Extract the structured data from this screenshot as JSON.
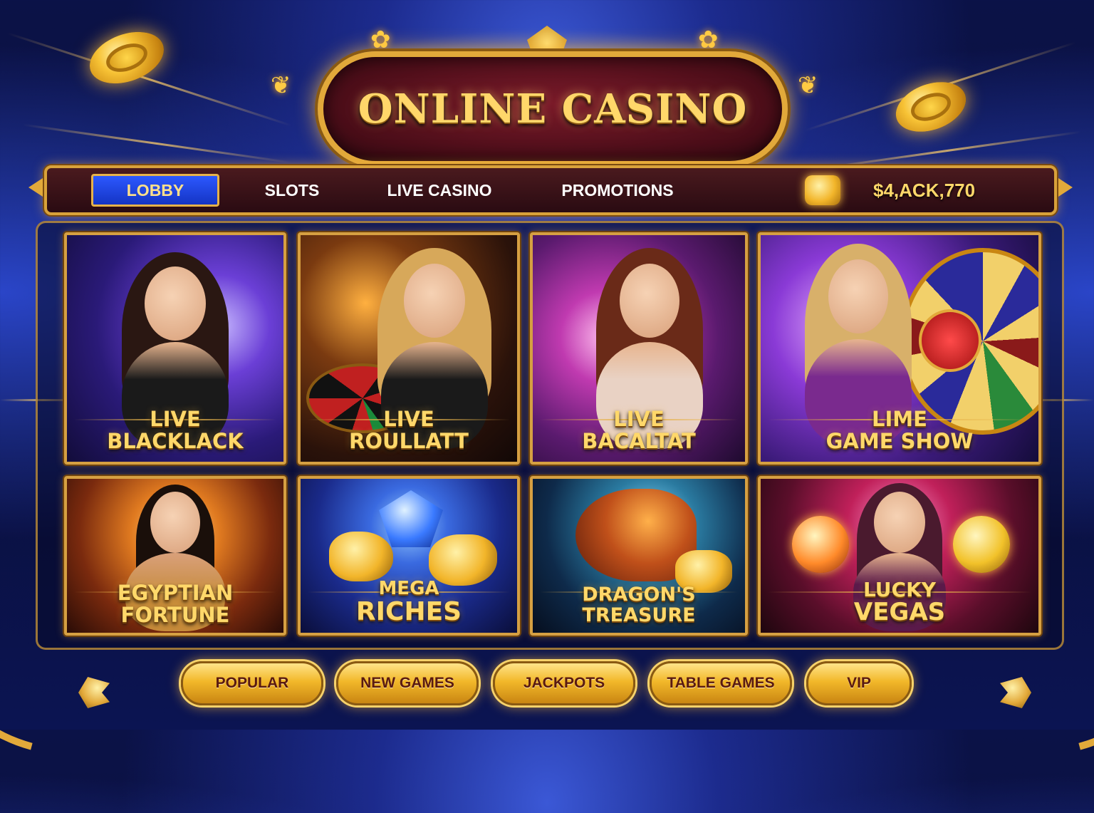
{
  "header": {
    "title": "ONLINE CASINO"
  },
  "nav": {
    "tabs": [
      {
        "label": "LOBBY",
        "active": true
      },
      {
        "label": "SLOTS",
        "active": false
      },
      {
        "label": "LIVE CASINO",
        "active": false
      },
      {
        "label": "PROMOTIONS",
        "active": false
      }
    ],
    "balance": "$4,ACK,770"
  },
  "games": [
    {
      "line1": "LIVE",
      "line2": "BLACKLACK"
    },
    {
      "line1": "LIVE",
      "line2": "ROULLATT"
    },
    {
      "line1": "LIVE",
      "line2": "BACALTAT"
    },
    {
      "line1": "LIME",
      "line2": "GAME SHOW"
    },
    {
      "line1": "EGYPTIAN",
      "line2": "FORTUNE"
    },
    {
      "line1": "MEGA",
      "line2": "RICHES"
    },
    {
      "line1": "DRAGON'S",
      "line2": "TREASURE"
    },
    {
      "line1": "LUCKY",
      "line2": "VEGAS"
    }
  ],
  "categories": [
    "POPULAR",
    "NEW GAMES",
    "JACKPOTS",
    "TABLE GAMES",
    "VIP"
  ],
  "colors": {
    "gold": "#e2a93a",
    "nav_active": "#1f48e8",
    "plaque": "#5a1220"
  },
  "icons": [
    "coin-icon",
    "treasure-chest-icon",
    "arrow-left-icon",
    "arrow-right-icon"
  ]
}
